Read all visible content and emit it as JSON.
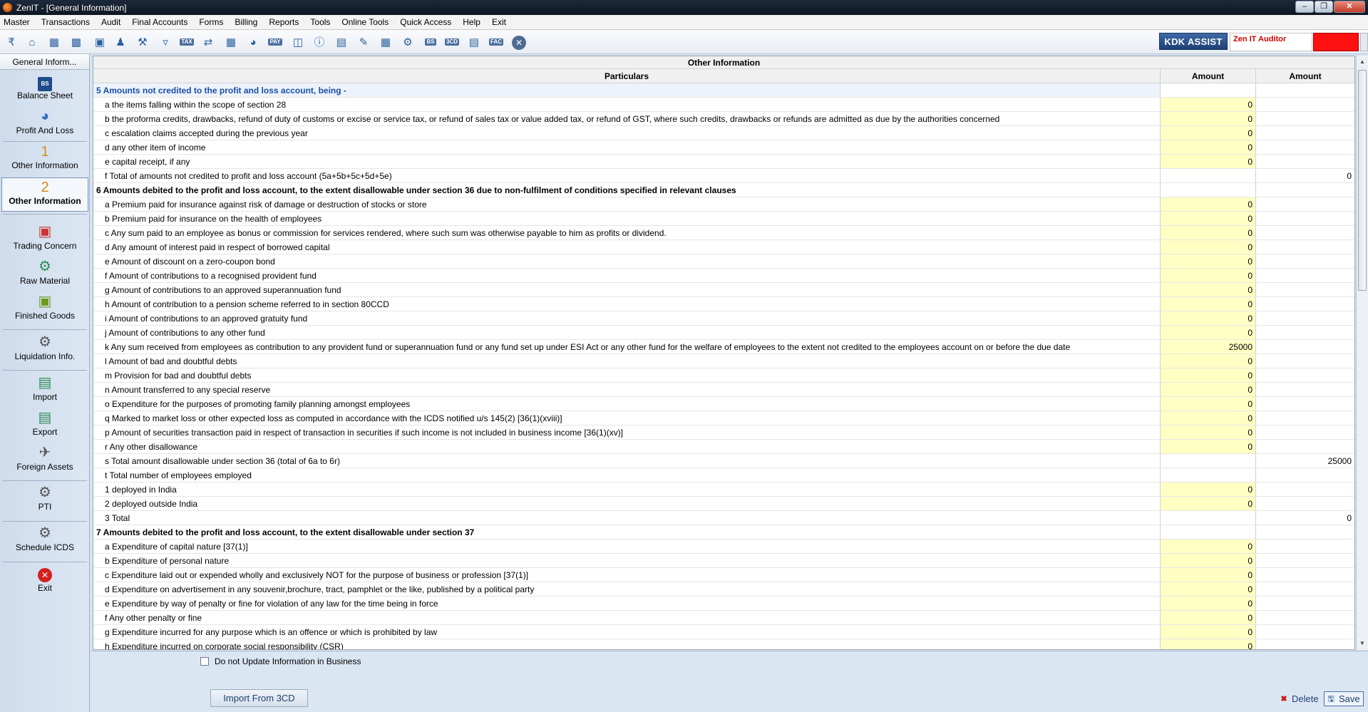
{
  "window": {
    "title": "ZenIT - [General Information]"
  },
  "menu": [
    "Master",
    "Transactions",
    "Audit",
    "Final Accounts",
    "Forms",
    "Billing",
    "Reports",
    "Tools",
    "Online Tools",
    "Quick Access",
    "Help",
    "Exit"
  ],
  "toolbar": {
    "icons": [
      "rupee-icon",
      "home-icon",
      "building-icon",
      "bar-chart-icon",
      "gift-icon",
      "users-icon",
      "hammer-icon",
      "filter-icon",
      "tax-icon",
      "transfer-icon",
      "calculator-icon",
      "pie-chart-icon",
      "pay-icon",
      "book-icon",
      "info-icon",
      "report-icon",
      "edit-doc-icon",
      "calendar-icon",
      "settings-doc-icon",
      "bs-icon",
      "3cd-icon",
      "form-icon",
      "fac-icon",
      "close-circle-icon"
    ],
    "labels": {
      "tax": "TAX",
      "pay": "PAY",
      "bs": "BS",
      "cd": "3CD",
      "fac": "FAC"
    },
    "kdk_assist": "KDK ASSIST",
    "zen_auditor": "Zen IT Auditor",
    "accent": "#ff1010"
  },
  "sidebar": {
    "header": "General Inform...",
    "items": [
      {
        "label": "Balance Sheet",
        "icon": "balance-sheet-icon"
      },
      {
        "label": "Profit And Loss",
        "icon": "pie-chart-icon"
      },
      {
        "label": "Other Information",
        "num": "1"
      },
      {
        "label": "Other Information",
        "num": "2"
      },
      {
        "label": "Trading Concern",
        "icon": "trading-icon"
      },
      {
        "label": "Raw Material",
        "icon": "raw-material-icon"
      },
      {
        "label": "Finished Goods",
        "icon": "finished-goods-icon"
      },
      {
        "label": "Liquidation Info.",
        "icon": "gears-icon"
      },
      {
        "label": "Import",
        "icon": "import-icon"
      },
      {
        "label": "Export",
        "icon": "export-icon"
      },
      {
        "label": "Foreign Assets",
        "icon": "airplane-icon"
      },
      {
        "label": "PTI",
        "icon": "gears-icon"
      },
      {
        "label": "Schedule ICDS",
        "icon": "gears-icon"
      },
      {
        "label": "Exit",
        "icon": "exit-icon"
      }
    ]
  },
  "grid": {
    "title": "Other Information",
    "headers": [
      "Particulars",
      "Amount",
      "Amount"
    ],
    "rows": [
      {
        "type": "sec-blue",
        "text": "5 Amounts not credited to the profit and loss account, being -",
        "a1": "",
        "a2": ""
      },
      {
        "type": "input",
        "text": "a the items falling within the scope of section 28",
        "a1": "0",
        "a2": ""
      },
      {
        "type": "input",
        "text": "b the proforma credits, drawbacks, refund of duty of customs or excise or service tax, or refund of sales tax or value added tax, or refund of GST, where such credits, drawbacks or refunds are admitted as due by the authorities concerned",
        "a1": "0",
        "a2": ""
      },
      {
        "type": "input",
        "text": "c escalation claims accepted during the previous year",
        "a1": "0",
        "a2": ""
      },
      {
        "type": "input",
        "text": "d any other item of income",
        "a1": "0",
        "a2": ""
      },
      {
        "type": "input",
        "text": "e capital receipt, if any",
        "a1": "0",
        "a2": ""
      },
      {
        "type": "total",
        "text": "f Total of amounts not credited to profit and loss account (5a+5b+5c+5d+5e)",
        "a1": "",
        "a2": "0"
      },
      {
        "type": "sec",
        "text": "6 Amounts debited to the profit and loss account, to the extent disallowable under section 36 due to non-fulfilment of conditions specified in relevant clauses",
        "a1": "",
        "a2": ""
      },
      {
        "type": "input",
        "text": "a Premium paid for insurance against risk of damage or destruction of stocks or store",
        "a1": "0",
        "a2": ""
      },
      {
        "type": "input",
        "text": "b Premium paid for insurance on the health of employees",
        "a1": "0",
        "a2": ""
      },
      {
        "type": "input",
        "text": "c Any sum paid to an employee as bonus or commission for services rendered, where such sum was otherwise payable to him as profits or dividend.",
        "a1": "0",
        "a2": ""
      },
      {
        "type": "input",
        "text": "d Any amount of interest paid in respect of borrowed capital",
        "a1": "0",
        "a2": ""
      },
      {
        "type": "input",
        "text": "e Amount of discount on a zero-coupon bond",
        "a1": "0",
        "a2": ""
      },
      {
        "type": "input",
        "text": "f Amount of contributions to a recognised provident fund",
        "a1": "0",
        "a2": ""
      },
      {
        "type": "input",
        "text": "g Amount of contributions to an approved superannuation fund",
        "a1": "0",
        "a2": ""
      },
      {
        "type": "input",
        "text": "h Amount of contribution to a pension scheme referred to in section 80CCD",
        "a1": "0",
        "a2": ""
      },
      {
        "type": "input",
        "text": "i Amount of contributions to an approved gratuity fund",
        "a1": "0",
        "a2": ""
      },
      {
        "type": "input",
        "text": "j Amount of contributions to any other fund",
        "a1": "0",
        "a2": ""
      },
      {
        "type": "input",
        "text": "k Any sum received from employees as contribution to any provident fund or superannuation fund or any fund set up under ESI Act or any other fund for the welfare of employees to the extent not credited to the employees account on or  before the due date",
        "a1": "25000",
        "a2": ""
      },
      {
        "type": "input",
        "text": "l Amount of bad and doubtful debts",
        "a1": "0",
        "a2": ""
      },
      {
        "type": "input",
        "text": "m Provision for bad and doubtful debts",
        "a1": "0",
        "a2": ""
      },
      {
        "type": "input",
        "text": "n Amount transferred to any special reserve",
        "a1": "0",
        "a2": ""
      },
      {
        "type": "input",
        "text": "o Expenditure for the purposes of promoting family planning amongst employees",
        "a1": "0",
        "a2": ""
      },
      {
        "type": "input",
        "text": "q Marked to market loss or other expected loss as computed in accordance with the ICDS notified u/s 145(2) [36(1)(xviii)]",
        "a1": "0",
        "a2": ""
      },
      {
        "type": "input",
        "text": "p Amount of securities transaction paid in respect of transaction in securities if such income is not included in business income [36(1)(xv)]",
        "a1": "0",
        "a2": ""
      },
      {
        "type": "input",
        "text": "r Any other disallowance",
        "a1": "0",
        "a2": ""
      },
      {
        "type": "total",
        "text": "s Total amount disallowable under section 36 (total of 6a to 6r)",
        "a1": "",
        "a2": "25000"
      },
      {
        "type": "total",
        "text": "t Total  number of employees employed",
        "a1": "",
        "a2": ""
      },
      {
        "type": "input",
        "text": "1 deployed in India",
        "a1": "0",
        "a2": ""
      },
      {
        "type": "input",
        "text": "2 deployed outside India",
        "a1": "0",
        "a2": ""
      },
      {
        "type": "total",
        "text": "3 Total",
        "a1": "",
        "a2": "0"
      },
      {
        "type": "sec",
        "text": "7 Amounts debited to the profit and loss account, to the extent disallowable under section 37",
        "a1": "",
        "a2": ""
      },
      {
        "type": "input",
        "text": "a Expenditure of capital nature [37(1)]",
        "a1": "0",
        "a2": ""
      },
      {
        "type": "input",
        "text": "b Expenditure of personal nature",
        "a1": "0",
        "a2": ""
      },
      {
        "type": "input",
        "text": "c Expenditure laid out or expended wholly and exclusively NOT for the purpose of business or profession [37(1)]",
        "a1": "0",
        "a2": ""
      },
      {
        "type": "input",
        "text": "d Expenditure on advertisement in any souvenir,brochure, tract, pamphlet or the like, published by a political party",
        "a1": "0",
        "a2": ""
      },
      {
        "type": "input",
        "text": "e Expenditure by way of penalty or fine for violation of any law for the time being in force",
        "a1": "0",
        "a2": ""
      },
      {
        "type": "input",
        "text": "f Any other penalty or fine",
        "a1": "0",
        "a2": ""
      },
      {
        "type": "input",
        "text": "g Expenditure incurred for any purpose which is an offence or which is prohibited by law",
        "a1": "0",
        "a2": ""
      },
      {
        "type": "input",
        "text": "h Expenditure incurred on corporate social responsibility (CSR)",
        "a1": "0",
        "a2": ""
      }
    ]
  },
  "bottom": {
    "checkbox_label": "Do not Update Information in Business",
    "import_button": "Import From 3CD",
    "delete_button": "Delete",
    "save_button": "Save"
  }
}
